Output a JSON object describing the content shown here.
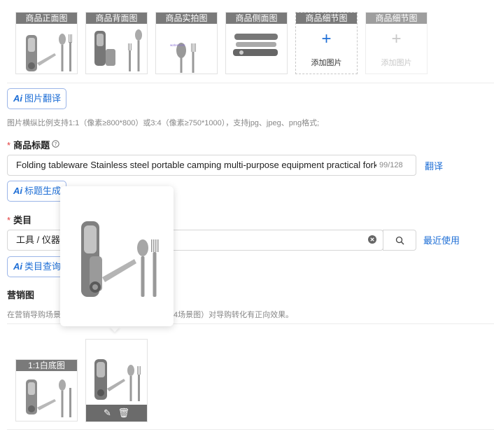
{
  "image_slots": [
    {
      "label": "商品正面图"
    },
    {
      "label": "商品背面图"
    },
    {
      "label": "商品实拍图"
    },
    {
      "label": "商品侧面图"
    },
    {
      "label": "商品细节图",
      "add_text": "添加图片"
    },
    {
      "label": "商品细节图",
      "add_text": "添加图片"
    }
  ],
  "ai_image_translate": {
    "ai": "Ai",
    "label": "图片翻译"
  },
  "image_hint": "图片横纵比例支持1:1（像素≥800*800）或3:4（像素≥750*1000），支持jpg、jpeg、png格式;",
  "title_section": {
    "required_mark": "*",
    "label": "商品标题",
    "help_icon": "question-circle-icon",
    "value": "Folding tableware Stainless steel portable camping multi-purpose equipment practical fork",
    "counter": "99/128",
    "translate_link": "翻译"
  },
  "ai_title_generate": {
    "ai": "Ai",
    "label": "标题生成"
  },
  "category_section": {
    "required_mark": "*",
    "label": "类目",
    "value": "工具 / 仪器",
    "recent_link": "最近使用"
  },
  "ai_category_query": {
    "ai": "Ai",
    "label": "类目查询"
  },
  "marketing_section": {
    "label": "营销图",
    "hint_left": "在营销导购场景",
    "hint_right": "4场景图）对导购转化有正向效果。",
    "slot_label": "1:1白底图"
  },
  "colors": {
    "accent": "#1f6fd6",
    "required": "#e23b3b"
  }
}
